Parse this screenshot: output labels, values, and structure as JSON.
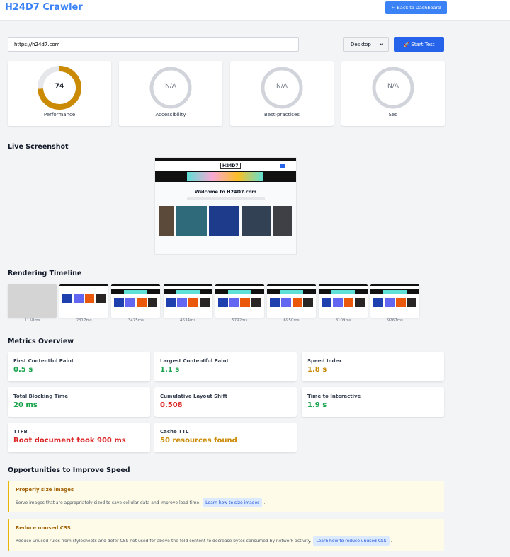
{
  "header": {
    "title": "H24D7 Crawler",
    "back_label": "← Back to Dashboard"
  },
  "controls": {
    "url": "https://h24d7.com",
    "device": "Desktop",
    "start_label": "🚀 Start Test"
  },
  "scores": [
    {
      "label": "Performance",
      "value": "74",
      "fraction": 0.74,
      "color": "#ca8a04"
    },
    {
      "label": "Accessibility",
      "value": "N/A"
    },
    {
      "label": "Best-practices",
      "value": "N/A"
    },
    {
      "label": "Seo",
      "value": "N/A"
    }
  ],
  "live": {
    "heading": "Live Screenshot",
    "site_logo": "H24D7",
    "welcome": "Welcome to H24D7.com"
  },
  "timeline": {
    "heading": "Rendering Timeline",
    "frames": [
      "1158ms",
      "2317ms",
      "3475ms",
      "4634ms",
      "5792ms",
      "6950ms",
      "8109ms",
      "9267ms"
    ]
  },
  "metrics": {
    "heading": "Metrics Overview",
    "items": [
      {
        "label": "First Contentful Paint",
        "value": "0.5 s",
        "color": "#16a34a"
      },
      {
        "label": "Largest Contentful Paint",
        "value": "1.1 s",
        "color": "#16a34a"
      },
      {
        "label": "Speed Index",
        "value": "1.8 s",
        "color": "#ca8a04"
      },
      {
        "label": "Total Blocking Time",
        "value": "20 ms",
        "color": "#16a34a"
      },
      {
        "label": "Cumulative Layout Shift",
        "value": "0.508",
        "color": "#dc2626"
      },
      {
        "label": "Time to Interactive",
        "value": "1.9 s",
        "color": "#16a34a"
      },
      {
        "label": "TTFB",
        "value": "Root document took 900 ms",
        "color": "#dc2626"
      },
      {
        "label": "Cache TTL",
        "value": "50 resources found",
        "color": "#ca8a04"
      }
    ]
  },
  "opportunities": {
    "heading": "Opportunities to Improve Speed",
    "items": [
      {
        "title": "Properly size images",
        "desc": "Serve images that are appropriately-sized to save cellular data and improve load time.",
        "link": "Learn how to size images",
        "end": "."
      },
      {
        "title": "Reduce unused CSS",
        "desc": "Reduce unused rules from stylesheets and defer CSS not used for above-the-fold content to decrease bytes consumed by network activity.",
        "link": "Learn how to reduce unused CSS",
        "end": "."
      }
    ]
  }
}
